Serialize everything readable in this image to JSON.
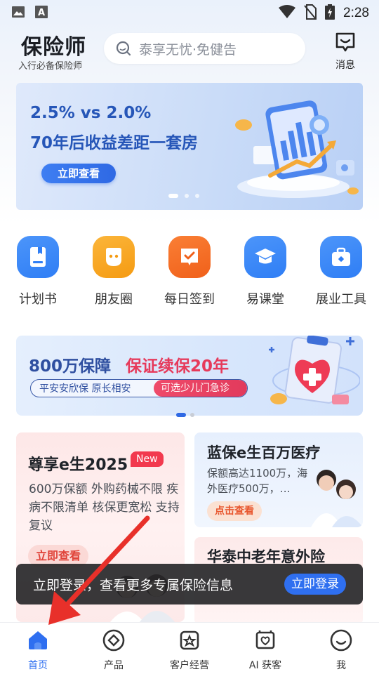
{
  "status_bar": {
    "time": "2:28",
    "icons": [
      "image-icon",
      "font-icon",
      "wifi-icon",
      "no-sim-icon",
      "battery-icon"
    ]
  },
  "header": {
    "title": "保险师",
    "subtitle": "入行必备保险师",
    "search_placeholder": "泰享无忧·免健告",
    "message_label": "消息"
  },
  "hero": {
    "line1": "2.5% vs 2.0%",
    "line2": "70年后收益差距一套房",
    "button": "立即查看",
    "slide_count": 3,
    "active_slide": 1
  },
  "quick_entries": [
    {
      "label": "计划书",
      "icon": "plan-book-icon",
      "color": "#2f7ef5"
    },
    {
      "label": "朋友圈",
      "icon": "moments-icon",
      "color": "#f7a21b"
    },
    {
      "label": "每日签到",
      "icon": "checkin-icon",
      "color": "#f36b1f"
    },
    {
      "label": "易课堂",
      "icon": "graduation-cap-icon",
      "color": "#2f7ef5"
    },
    {
      "label": "展业工具",
      "icon": "toolbox-icon",
      "color": "#2f7ef5"
    }
  ],
  "promo_banner": {
    "title_a": "800万保障",
    "title_b": "保证续保20年",
    "pill_a": "平安安欣保 原长相安",
    "pill_b": "可选少儿门急诊",
    "slide_count": 2,
    "active_slide": 1
  },
  "products": {
    "card_a": {
      "title": "尊享e生2025",
      "badge": "New",
      "desc": "600万保额 外购药械不限 疾病不限清单 核保更宽松 支持复议",
      "button": "立即查看"
    },
    "card_b": {
      "title": "蓝保e生百万医疗",
      "desc": "保额高达1100万，海外医疗500万，…",
      "button": "点击查看"
    },
    "card_c": {
      "title": "华泰中老年意外险"
    }
  },
  "toast": {
    "text": "立即登录，查看更多专属保险信息",
    "button": "立即登录"
  },
  "tabbar": [
    {
      "label": "首页",
      "icon": "home-icon",
      "active": true
    },
    {
      "label": "产品",
      "icon": "product-icon",
      "active": false
    },
    {
      "label": "客户经营",
      "icon": "customer-icon",
      "active": false
    },
    {
      "label": "AI 获客",
      "icon": "ai-acquire-icon",
      "active": false
    },
    {
      "label": "我",
      "icon": "profile-icon",
      "active": false
    }
  ],
  "colors": {
    "accent": "#2f6ff0",
    "hero_text": "#2656b8",
    "promo_red": "#e63a5b",
    "new_badge": "#f2394e"
  }
}
